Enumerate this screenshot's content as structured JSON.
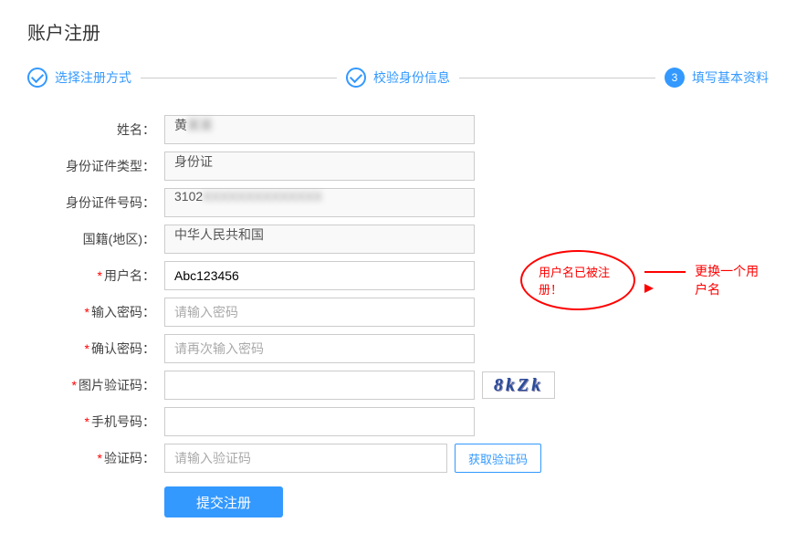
{
  "page": {
    "title": "账户注册"
  },
  "steps": {
    "s1": {
      "label": "选择注册方式"
    },
    "s2": {
      "label": "校验身份信息"
    },
    "s3": {
      "num": "3",
      "label": "填写基本资料"
    }
  },
  "labels": {
    "name": "姓名：",
    "id_type": "身份证件类型：",
    "id_no": "身份证件号码：",
    "nation": "国籍(地区)：",
    "username": "用户名：",
    "pwd": "输入密码：",
    "pwd2": "确认密码：",
    "captcha": "图片验证码：",
    "mobile": "手机号码：",
    "sms": "验证码："
  },
  "values": {
    "name_visible": "黄",
    "name_hidden": "某某",
    "id_type": "身份证",
    "id_no_visible": "3102",
    "id_no_hidden": "XXXXXXXXXXXXXX",
    "nation": "中华人民共和国",
    "username": "Abc123456"
  },
  "placeholders": {
    "pwd": "请输入密码",
    "pwd2": "请再次输入密码",
    "sms": "请输入验证码"
  },
  "captcha": {
    "text": "8kZk"
  },
  "buttons": {
    "get_sms": "获取验证码",
    "submit": "提交注册"
  },
  "annotation": {
    "error": "用户名已被注册！",
    "hint": "更换一个用户名"
  },
  "req_mark": "*"
}
